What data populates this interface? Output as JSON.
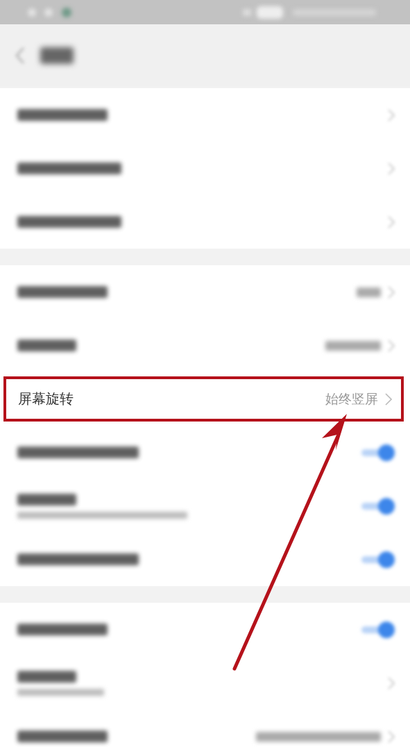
{
  "sections": [
    {
      "rows": [
        {
          "kind": "chevron"
        },
        {
          "kind": "chevron"
        },
        {
          "kind": "chevron"
        }
      ]
    },
    {
      "rows": [
        {
          "kind": "value"
        },
        {
          "kind": "value"
        },
        {
          "kind": "value",
          "label": "屏幕旋转",
          "value": "始终竖屏",
          "highlighted": true
        },
        {
          "kind": "toggle",
          "on": true
        },
        {
          "kind": "toggle",
          "on": true,
          "subtitle": true
        },
        {
          "kind": "toggle",
          "on": true
        }
      ]
    },
    {
      "rows": [
        {
          "kind": "toggle",
          "on": true
        },
        {
          "kind": "chevron",
          "subtitle": true
        },
        {
          "kind": "value"
        }
      ]
    }
  ],
  "annotation": {
    "kind": "arrow"
  }
}
